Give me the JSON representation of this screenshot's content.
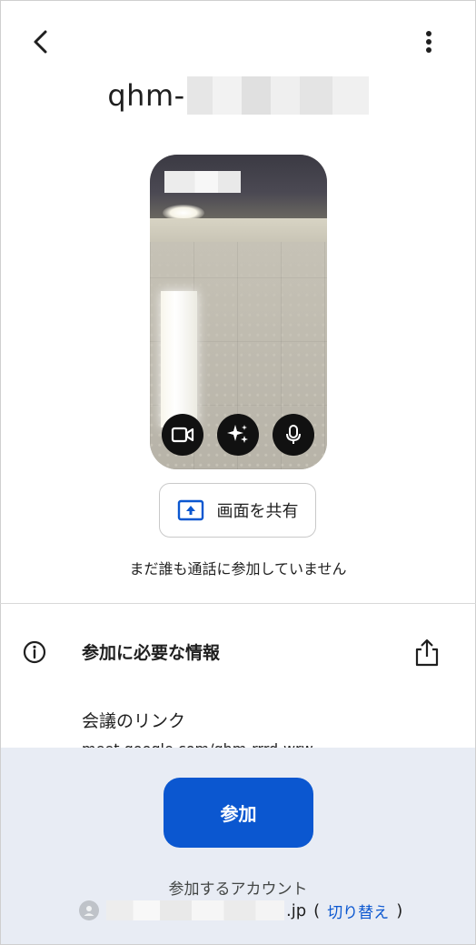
{
  "header": {
    "back_icon": "arrow-back-icon",
    "more_icon": "more-vert-icon",
    "meeting_code_prefix": "qhm-"
  },
  "preview": {
    "controls": [
      {
        "name": "video-toggle",
        "icon": "videocam-icon"
      },
      {
        "name": "effects",
        "icon": "sparkle-icon"
      },
      {
        "name": "mic-toggle",
        "icon": "mic-icon"
      }
    ]
  },
  "share": {
    "label": "画面を共有",
    "icon": "present-to-all-icon"
  },
  "status": {
    "nobody_text": "まだ誰も通話に参加していません"
  },
  "info": {
    "heading": "参加に必要な情報",
    "link_label": "会議のリンク",
    "link_url": "meet.google.com/qhm-rrrd-wrw"
  },
  "bottom": {
    "join_label": "参加",
    "account_label": "参加するアカウント",
    "email_suffix": ".jp",
    "switch_open": "(",
    "switch_label": "切り替え",
    "switch_close": ")"
  },
  "colors": {
    "accent": "#0b57d0",
    "bottom_bg": "#e8ecf4"
  }
}
